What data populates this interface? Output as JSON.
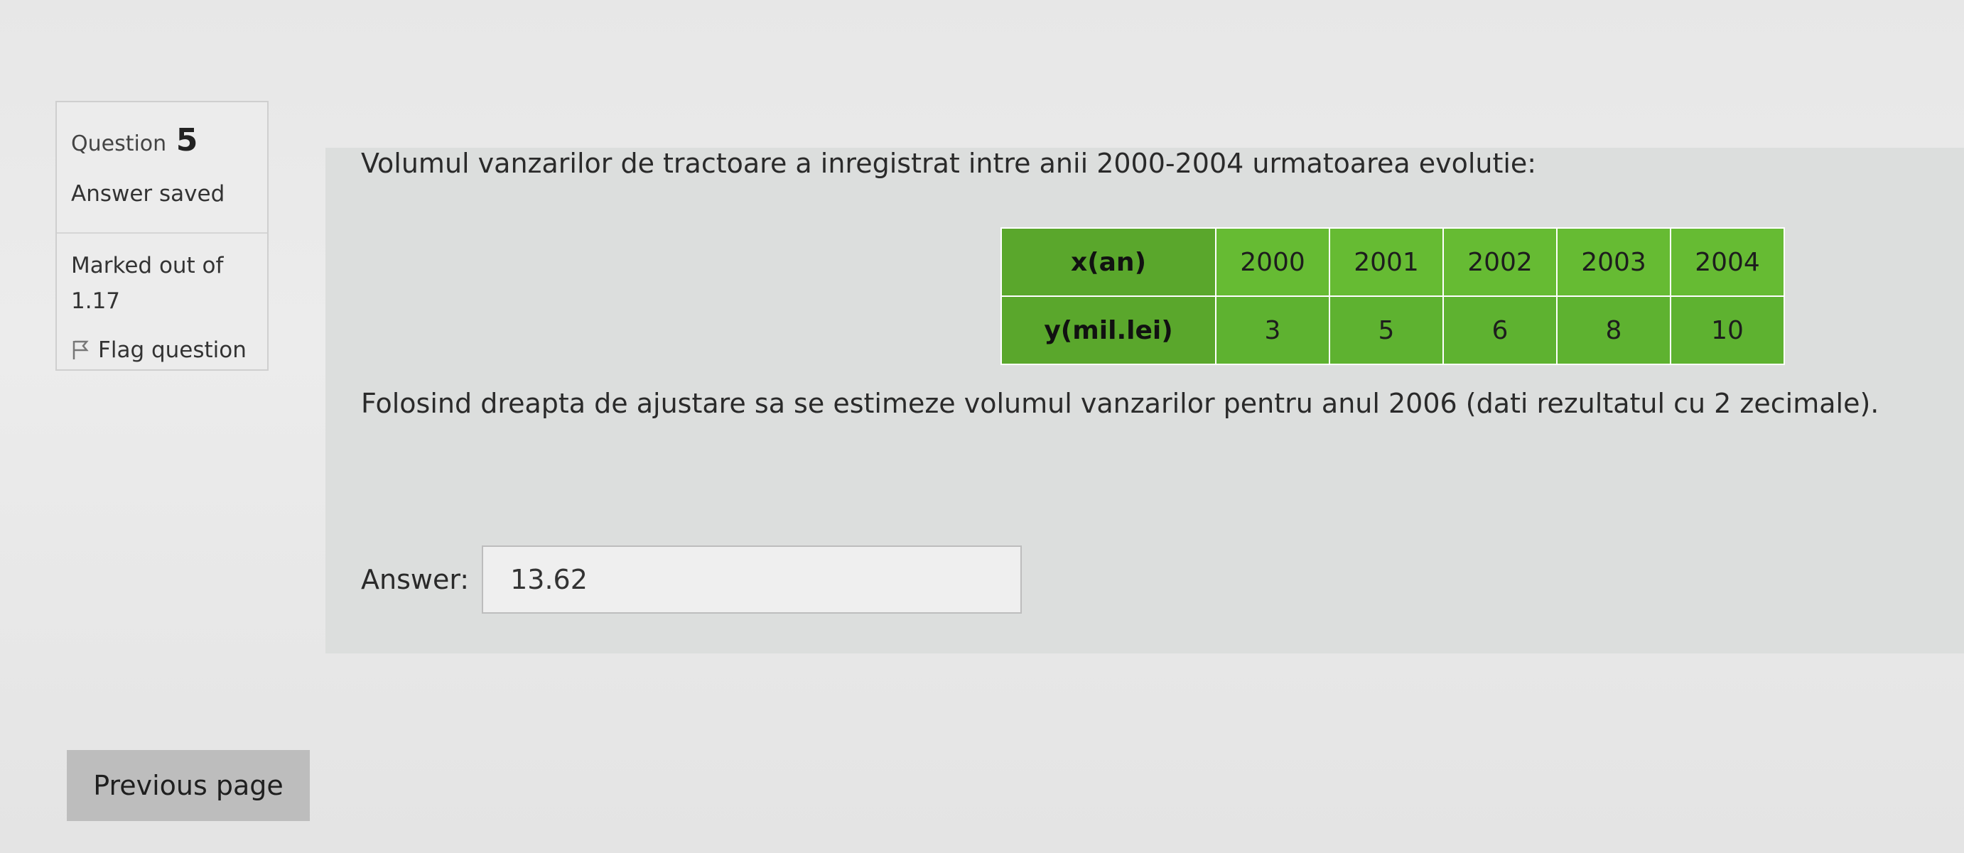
{
  "question_info": {
    "label": "Question",
    "number": "5",
    "state": "Answer saved",
    "grade_line1": "Marked out of",
    "grade_line2": "1.17",
    "flag_label": "Flag question"
  },
  "question": {
    "text": "Volumul vanzarilor de tractoare a inregistrat intre anii 2000-2004 urmatoarea evolutie:",
    "table": {
      "row1_header": "x(an)",
      "row1": [
        "2000",
        "2001",
        "2002",
        "2003",
        "2004"
      ],
      "row2_header": "y(mil.lei)",
      "row2": [
        "3",
        "5",
        "6",
        "8",
        "10"
      ]
    },
    "text2": "Folosind dreapta de ajustare sa se estimeze volumul vanzarilor pentru anul 2006 (dati rezultatul cu 2 zecimale)."
  },
  "answer": {
    "label": "Answer:",
    "value": "13.62"
  },
  "navigation": {
    "previous_label": "Previous page"
  },
  "colors": {
    "table_green": "#66bb33",
    "table_header_green": "#5aa72c",
    "content_bg": "#dcdedd"
  }
}
